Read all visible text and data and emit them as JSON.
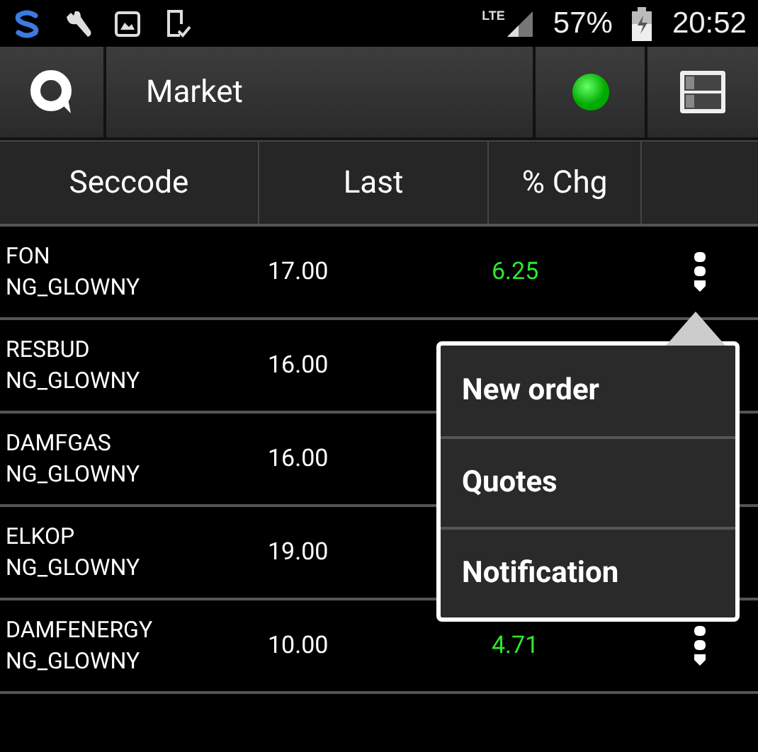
{
  "status_bar": {
    "network": "LTE",
    "battery": "57%",
    "time": "20:52"
  },
  "toolbar": {
    "title": "Market",
    "connected": true
  },
  "table": {
    "columns": [
      "Seccode",
      "Last",
      "% Chg"
    ],
    "rows": [
      {
        "seccode": "FON",
        "market": "NG_GLOWNY",
        "last": "17.00",
        "change": "6.25",
        "more_button": true
      },
      {
        "seccode": "RESBUD",
        "market": "NG_GLOWNY",
        "last": "16.00"
      },
      {
        "seccode": "DAMFGAS",
        "market": "NG_GLOWNY",
        "last": "16.00"
      },
      {
        "seccode": "ELKOP",
        "market": "NG_GLOWNY",
        "last": "19.00"
      },
      {
        "seccode": "DAMFENERGY",
        "market": "NG_GLOWNY",
        "last": "10.00",
        "change": "4.71",
        "more_button": true
      }
    ]
  },
  "popup_menu": {
    "items": [
      "New order",
      "Quotes",
      "Notification"
    ]
  }
}
